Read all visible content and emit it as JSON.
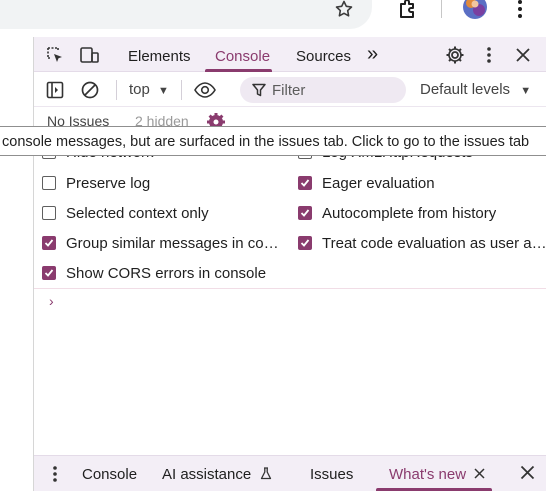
{
  "colors": {
    "accent": "#8a3b6e",
    "toolbar_bg": "#f3eef6",
    "filter_bg": "#efe9f2"
  },
  "chrome": {
    "icons": [
      "star-icon",
      "extension-puzzle-icon",
      "profile-avatar",
      "more-vert-icon"
    ]
  },
  "devtools": {
    "tabs": [
      {
        "label": "Elements",
        "active": false
      },
      {
        "label": "Console",
        "active": true
      },
      {
        "label": "Sources",
        "active": false
      }
    ],
    "more_tabs_glyph": "»",
    "toolbar": {
      "context": "top",
      "filter_placeholder": "Filter",
      "levels": "Default levels",
      "issues_link": "No Issues",
      "hidden_count": "2 hidden"
    },
    "tooltip": "console messages, but are surfaced in the issues tab. Click to go to the issues tab",
    "settings": {
      "left": [
        {
          "label": "Hide network",
          "checked": false
        },
        {
          "label": "Preserve log",
          "checked": false
        },
        {
          "label": "Selected context only",
          "checked": false
        },
        {
          "label": "Group similar messages in console",
          "checked": true
        },
        {
          "label": "Show CORS errors in console",
          "checked": true
        }
      ],
      "right": [
        {
          "label": "Log XMLHttpRequests",
          "checked": false
        },
        {
          "label": "Eager evaluation",
          "checked": true
        },
        {
          "label": "Autocomplete from history",
          "checked": true
        },
        {
          "label": "Treat code evaluation as user action",
          "checked": true
        }
      ]
    },
    "prompt_glyph": "›",
    "drawer": {
      "tabs": [
        {
          "label": "Console",
          "active": false
        },
        {
          "label": "AI assistance",
          "active": false
        },
        {
          "label": "Issues",
          "active": false
        },
        {
          "label": "What's new",
          "active": true
        }
      ]
    }
  }
}
